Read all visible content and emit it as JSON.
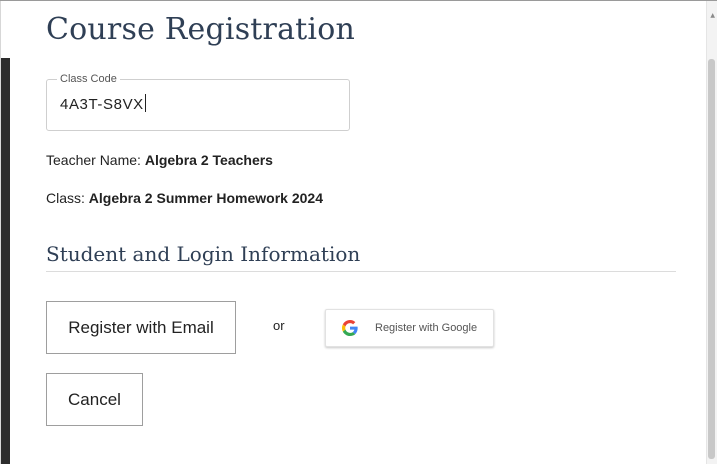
{
  "page": {
    "title": "Course Registration"
  },
  "class_code_field": {
    "label": "Class Code",
    "value": "4A3T-S8VX"
  },
  "teacher": {
    "label": "Teacher Name:",
    "value": "Algebra 2 Teachers"
  },
  "class_info": {
    "label": "Class:",
    "value": "Algebra 2 Summer Homework 2024"
  },
  "section": {
    "title": "Student and Login Information"
  },
  "actions": {
    "register_email_label": "Register with Email",
    "or_label": "or",
    "register_google_label": "Register with Google",
    "cancel_label": "Cancel"
  },
  "icons": {
    "google": "google-g-icon",
    "scroll_up": "scroll-up-arrow-icon"
  },
  "colors": {
    "heading": "#2f3f55",
    "google_blue": "#4285F4",
    "google_red": "#EA4335",
    "google_yellow": "#FBBC05",
    "google_green": "#34A853"
  }
}
